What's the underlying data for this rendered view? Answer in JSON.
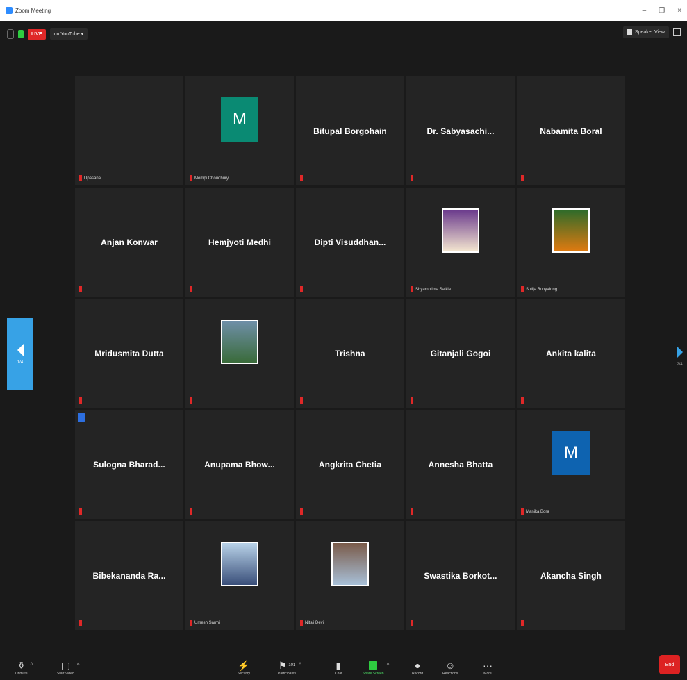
{
  "window": {
    "title": "Zoom Meeting",
    "controls": [
      "–",
      "❐",
      "×"
    ]
  },
  "topbar": {
    "live_badge": "LIVE",
    "live_target": "on YouTube ▾",
    "view_label": "Speaker View"
  },
  "pagination": {
    "left_label": "1/4",
    "right_label": "2/4"
  },
  "tiles": [
    {
      "center": "",
      "label": "Upasana",
      "avatar": ""
    },
    {
      "center": "",
      "label": "Mompi Choudhury",
      "avatar": "M",
      "avatar_color": "#0a8a73"
    },
    {
      "center": "Bitupal Borgohain",
      "label": ""
    },
    {
      "center": "Dr. Sabyasachi...",
      "label": ""
    },
    {
      "center": "Nabamita Boral",
      "label": ""
    },
    {
      "center": "Anjan Konwar",
      "label": ""
    },
    {
      "center": "Hemjyoti Medhi",
      "label": ""
    },
    {
      "center": "Dipti Visuddhan...",
      "label": ""
    },
    {
      "center": "",
      "label": "Shyamolima Saikia",
      "photo": true,
      "photo_colors": [
        "#6a3a8c",
        "#f4e6d0"
      ]
    },
    {
      "center": "",
      "label": "Sutija Bunyalong",
      "photo": true,
      "photo_colors": [
        "#2e6b2a",
        "#e07a10"
      ]
    },
    {
      "center": "Mridusmita Dutta",
      "label": ""
    },
    {
      "center": "",
      "label": "",
      "photo": true,
      "photo_colors": [
        "#6f8fa8",
        "#3a6b3a"
      ]
    },
    {
      "center": "Trishna",
      "label": ""
    },
    {
      "center": "Gitanjali Gogoi",
      "label": ""
    },
    {
      "center": "Ankita kalita",
      "label": ""
    },
    {
      "center": "Sulogna Bharad...",
      "label": "",
      "cc": true
    },
    {
      "center": "Anupama Bhow...",
      "label": ""
    },
    {
      "center": "Angkrita Chetia",
      "label": ""
    },
    {
      "center": "Annesha Bhatta",
      "label": ""
    },
    {
      "center": "",
      "label": "Manika Bora",
      "avatar": "M",
      "avatar_color": "#0e63b0"
    },
    {
      "center": "Bibekananda Ra...",
      "label": ""
    },
    {
      "center": "",
      "label": "Umesh Sarmi",
      "photo": true,
      "photo_colors": [
        "#b8d2e8",
        "#3a4f7a"
      ]
    },
    {
      "center": "",
      "label": "Nitali Devi",
      "photo": true,
      "photo_colors": [
        "#7a5b4a",
        "#a8c0d8"
      ]
    },
    {
      "center": "Swastika Borkot...",
      "label": ""
    },
    {
      "center": "Akancha Singh",
      "label": ""
    }
  ],
  "toolbar": {
    "unmute": "Unmute",
    "start_video": "Start Video",
    "security": "Security",
    "participants": "Participants",
    "participants_count": "101",
    "chat": "Chat",
    "share_screen": "Share Screen",
    "record": "Record",
    "reactions": "Reactions",
    "more": "More",
    "end": "End"
  }
}
